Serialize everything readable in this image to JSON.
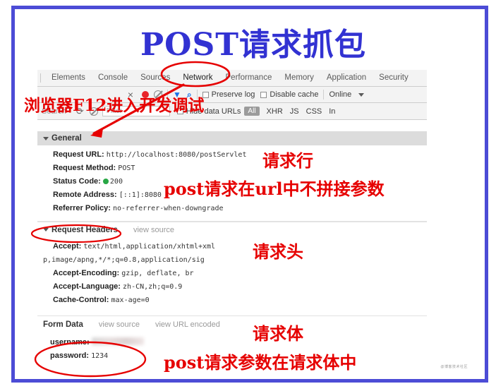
{
  "title": "POST请求抓包",
  "theme": {
    "frame_border": "#4c4cd6",
    "title_color": "#3232d2",
    "annotation_color": "#e60000",
    "tabbar_bg": "#f3f3f3",
    "section_header_bg": "#dcdcdc",
    "status_ok": "#28a745",
    "record_red": "#e8242a",
    "filter_blue": "#1a73e8"
  },
  "devtools": {
    "tabs": [
      {
        "label": "Elements",
        "active": false
      },
      {
        "label": "Console",
        "active": false
      },
      {
        "label": "Sources",
        "active": false
      },
      {
        "label": "Network",
        "active": true
      },
      {
        "label": "Performance",
        "active": false
      },
      {
        "label": "Memory",
        "active": false
      },
      {
        "label": "Application",
        "active": false
      },
      {
        "label": "Security",
        "active": false
      }
    ],
    "toolbar": {
      "close_icon": "×",
      "record_icon": "record-dot",
      "clear_icon": "clear-circle",
      "filter_icon": "▼",
      "search_icon": "⌕",
      "preserve_log_label": "Preserve log",
      "disable_cache_label": "Disable cache",
      "throttling_value": "Online",
      "throttling_caret": "▾"
    },
    "filterbar": {
      "search_placeholder": "Search",
      "refresh_icon": "⟳",
      "clear_icon": "clear-circle",
      "filter_placeholder": "Filter",
      "hide_data_urls_label": "Hide data URLs",
      "types": [
        "All",
        "XHR",
        "JS",
        "CSS",
        "In"
      ]
    },
    "sections": {
      "general": {
        "header": "General",
        "rows": [
          {
            "key": "Request URL:",
            "value": "http://localhost:8080/postServlet",
            "status_dot": false
          },
          {
            "key": "Request Method:",
            "value": "POST",
            "status_dot": false
          },
          {
            "key": "Status Code:",
            "value": "200",
            "status_dot": true
          },
          {
            "key": "Remote Address:",
            "value": "[::1]:8080",
            "status_dot": false
          },
          {
            "key": "Referrer Policy:",
            "value": "no-referrer-when-downgrade",
            "status_dot": false
          }
        ]
      },
      "request_headers": {
        "header": "Request Headers",
        "view_source": "view source",
        "rows": [
          {
            "key": "Accept:",
            "value": "text/html,application/xhtml+xml"
          },
          {
            "key": "",
            "value": "p,image/apng,*/*;q=0.8,application/sig"
          },
          {
            "key": "Accept-Encoding:",
            "value": "gzip, deflate, br"
          },
          {
            "key": "Accept-Language:",
            "value": "zh-CN,zh;q=0.9"
          },
          {
            "key": "Cache-Control:",
            "value": "max-age=0"
          }
        ]
      },
      "form_data": {
        "header": "Form Data",
        "view_source": "view source",
        "view_url_encoded": "view URL encoded",
        "rows": [
          {
            "key": "username:",
            "value": "",
            "blurred": true
          },
          {
            "key": "password:",
            "value": "1234",
            "blurred": false
          }
        ]
      }
    }
  },
  "annotations": {
    "browser_f12": "浏览器F12进入开发调试",
    "request_line": "请求行",
    "no_url_params": "post请求在url中不拼接参数",
    "request_headers": "请求头",
    "request_body": "请求体",
    "body_params": "post请求参数在请求体中"
  },
  "watermark": "@博客技术社区"
}
